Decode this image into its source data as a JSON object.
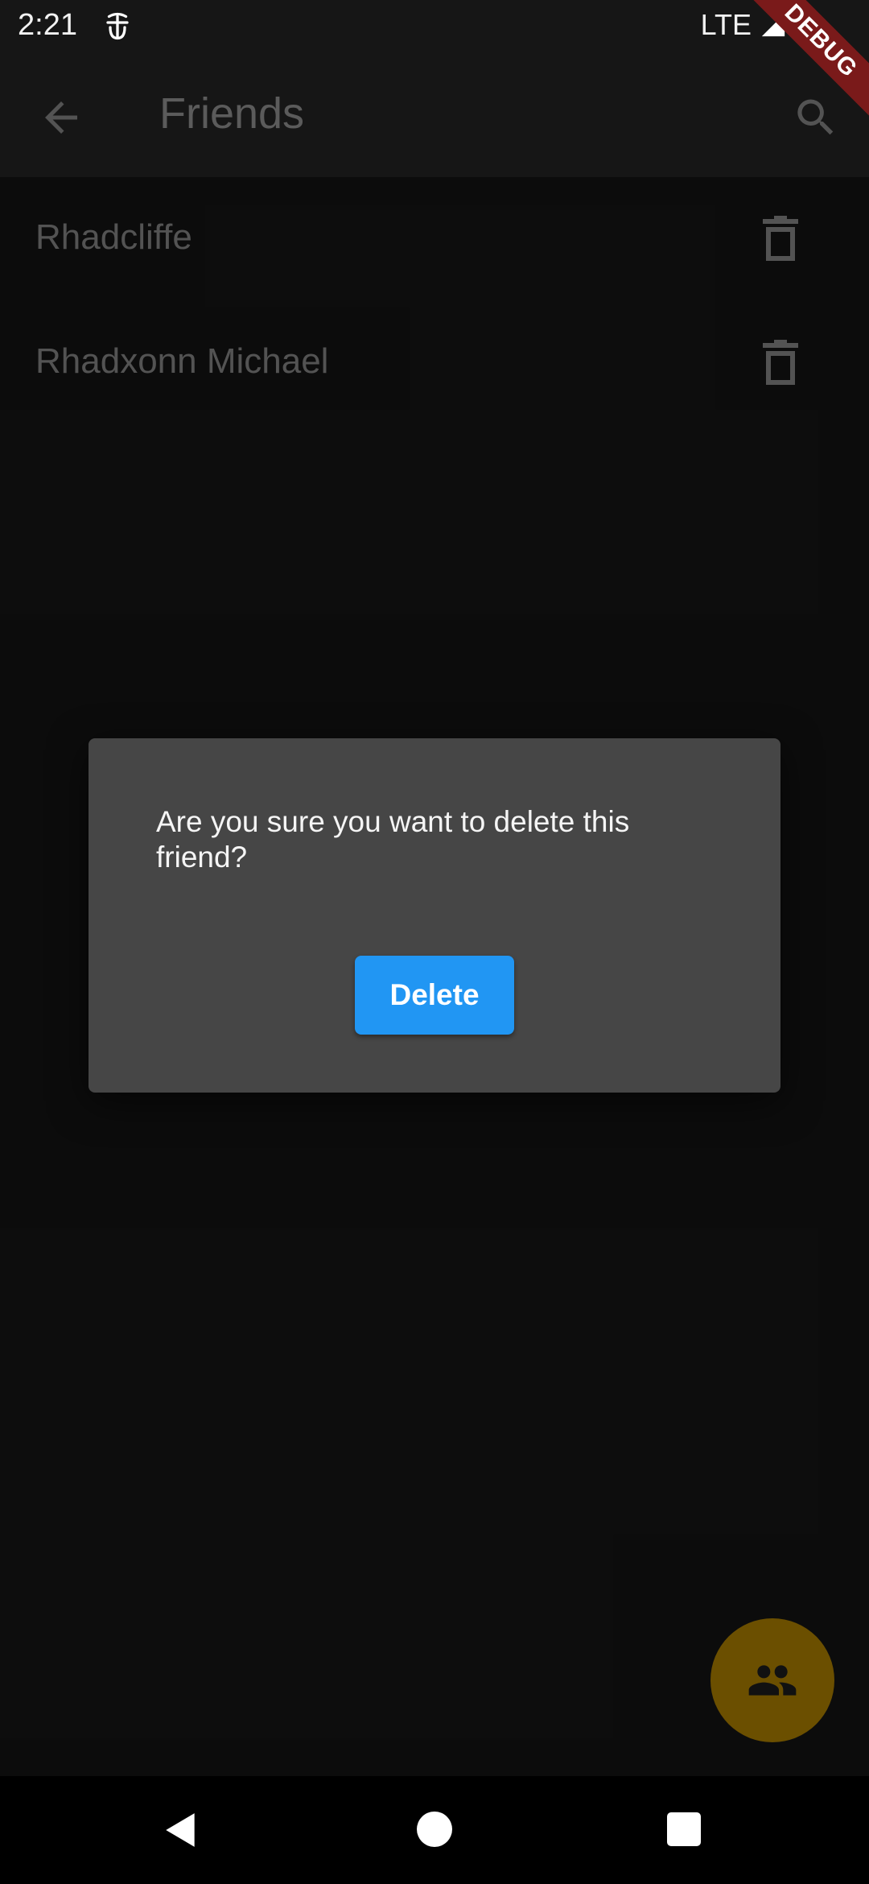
{
  "status_bar": {
    "time": "2:21",
    "network": "LTE",
    "debug_label": "DEBUG"
  },
  "app_bar": {
    "title": "Friends"
  },
  "friends": [
    {
      "name": "Rhadcliffe"
    },
    {
      "name": "Rhadxonn Michael"
    }
  ],
  "dialog": {
    "message": "Are you sure you want to delete this friend?",
    "delete_label": "Delete"
  },
  "colors": {
    "accent": "#2196f3",
    "fab": "#6b4f00",
    "debug_banner": "#7a1a1a"
  }
}
